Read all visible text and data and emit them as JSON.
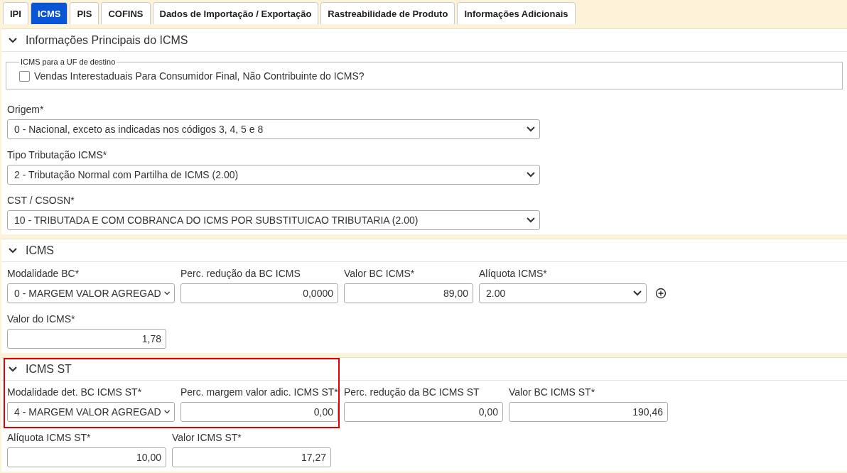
{
  "tabs": [
    {
      "label": "IPI",
      "selected": false
    },
    {
      "label": "ICMS",
      "selected": true
    },
    {
      "label": "PIS",
      "selected": false
    },
    {
      "label": "COFINS",
      "selected": false
    },
    {
      "label": "Dados de Importação / Exportação",
      "selected": false
    },
    {
      "label": "Rastreabilidade de Produto",
      "selected": false
    },
    {
      "label": "Informações Adicionais",
      "selected": false
    }
  ],
  "sections": [
    {
      "title": "Informações Principais do ICMS",
      "expanded": true,
      "highlighted": false,
      "fieldset": {
        "legend": "ICMS para a UF de destino",
        "checkbox": {
          "label": "Vendas Interestaduais Para Consumidor Final, Não Contribuinte do ICMS?",
          "checked": false
        }
      },
      "rows": [
        [
          {
            "kind": "select",
            "label": "Origem*",
            "value": "0 - Nacional, exceto as indicadas nos códigos 3, 4, 5 e 8"
          }
        ],
        [
          {
            "kind": "select",
            "label": "Tipo Tributação ICMS*",
            "value": "2 - Tributação Normal com Partilha de ICMS (2.00)"
          }
        ],
        [
          {
            "kind": "select",
            "label": "CST / CSOSN*",
            "value": "10 - TRIBUTADA E COM COBRANCA DO ICMS POR SUBSTITUICAO TRIBUTARIA (2.00)"
          }
        ]
      ]
    },
    {
      "title": "ICMS",
      "expanded": true,
      "highlighted": false,
      "rows": [
        [
          {
            "kind": "select",
            "label": "Modalidade BC*",
            "value": "0 - MARGEM VALOR AGREGAD"
          },
          {
            "kind": "input",
            "label": "Perc. redução da BC ICMS",
            "value": "0,0000"
          },
          {
            "kind": "input",
            "label": "Valor BC ICMS*",
            "value": "89,00"
          },
          {
            "kind": "select-add",
            "label": "Alíquota ICMS*",
            "value": "2.00"
          }
        ],
        [
          {
            "kind": "input",
            "label": "Valor do ICMS*",
            "value": "1,78"
          }
        ]
      ]
    },
    {
      "title": "ICMS ST",
      "expanded": true,
      "highlighted": true,
      "rows": [
        [
          {
            "kind": "select",
            "label": "Modalidade det. BC ICMS ST*",
            "value": "4 - MARGEM VALOR AGREGAD"
          },
          {
            "kind": "input",
            "label": "Perc. margem valor adic. ICMS ST*",
            "value": "0,00"
          },
          {
            "kind": "input",
            "label": "Perc. redução da BC ICMS ST",
            "value": "0,00"
          },
          {
            "kind": "input",
            "label": "Valor BC ICMS ST*",
            "value": "190,46"
          }
        ],
        [
          {
            "kind": "input",
            "label": "Alíquota ICMS ST*",
            "value": "10,00"
          },
          {
            "kind": "input",
            "label": "Valor ICMS ST*",
            "value": "17,27"
          }
        ]
      ]
    }
  ]
}
